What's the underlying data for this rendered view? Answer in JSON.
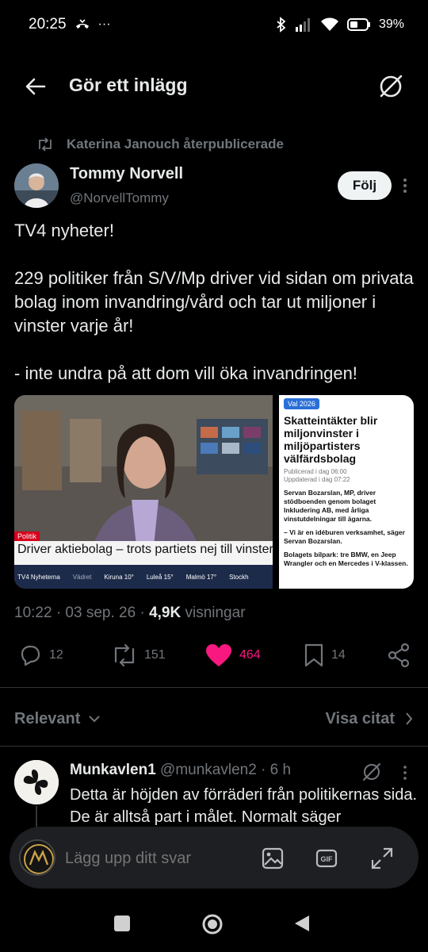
{
  "status_bar": {
    "time": "20:25",
    "extra": "···",
    "battery": "39%"
  },
  "header": {
    "title": "Gör ett inlägg"
  },
  "post": {
    "repost_by": "Katerina Janouch återpublicerade",
    "author_name": "Tommy Norvell",
    "author_handle": "@NorvellTommy",
    "follow_label": "Följ",
    "text": [
      "TV4 nyheter!",
      "229 politiker från S/V/Mp driver vid sidan om privata bolag inom invandring/vård och tar ut miljoner i vinster varje år!",
      "- inte undra på att dom vill öka invandringen!"
    ],
    "media": {
      "tv": {
        "tag": "Politik",
        "lower_third": "Driver aktiebolag – trots partiets nej till vinster",
        "ticker": [
          "TV4 Nyheterna",
          "Vädret",
          "Kiruna 10°",
          "Luleå 15°",
          "Malmö 17°",
          "Stockh"
        ]
      },
      "article": {
        "tag": "Val 2026",
        "headline": "Skatteintäkter blir miljonvinster i miljöpartisters välfärdsbolag",
        "published": "Publicerad i dag 06:00",
        "updated": "Uppdaterad i dag 07:22",
        "body": [
          "Servan Bozarslan, MP, driver stödboenden genom bolaget Inkludering AB, med årliga vinstutdelningar till ägarna.",
          "– Vi är en idéburen verksamhet, säger Servan Bozarslan.",
          "Bolagets bilpark: tre BMW, en Jeep Wrangler och en Mercedes i V-klassen."
        ]
      }
    },
    "meta_time": "10:22 · 03 sep. 26 ·",
    "views_count": "4,9K",
    "views_label": "visningar",
    "actions": {
      "replies": "12",
      "reposts": "151",
      "likes": "464",
      "bookmarks": "14"
    },
    "colors": {
      "like": "#f91880",
      "muted": "#71767b"
    }
  },
  "replies_section": {
    "sort_label": "Relevant",
    "quotes_label": "Visa citat",
    "reply": {
      "name": "Munkavlen1",
      "handle": "@munkavlen2 · 6 h",
      "text": "Detta är höjden av förräderi från politikernas sida. De är alltså part i målet. Normalt säger"
    }
  },
  "composer": {
    "placeholder": "Lägg upp ditt svar"
  },
  "icons": [
    "back-arrow-icon",
    "grok-icon",
    "repost-icon",
    "more-icon",
    "reply-icon",
    "like-icon",
    "bookmark-icon",
    "share-icon",
    "image-icon",
    "gif-icon",
    "expand-icon",
    "chevron-down-icon",
    "chevron-right-icon"
  ]
}
